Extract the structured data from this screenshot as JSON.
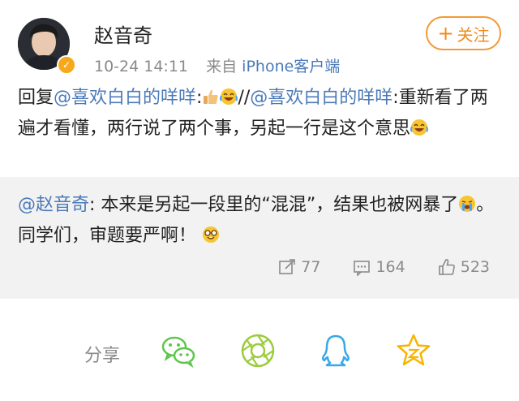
{
  "post": {
    "author": "赵音奇",
    "time": "10-24 14:11",
    "source_prefix": "来自",
    "source": "iPhone客户端",
    "follow_label": "关注",
    "content": {
      "reply_word": "回复",
      "mention1": "@喜欢白白的咩咩",
      "sep1": ":",
      "slash": "//",
      "mention2": "@喜欢白白的咩咩",
      "text2": ":重新看了两遍才看懂，两行说了两个事，另起一行是这个意思"
    }
  },
  "repost": {
    "mention": "@赵音奇",
    "text1": ": 本来是另起一段里的“混混”，结果也被网暴了",
    "text2": "。同学们，审题要严啊！",
    "stats": {
      "reposts": "77",
      "comments": "164",
      "likes": "523"
    }
  },
  "share": {
    "label": "分享",
    "targets": [
      "wechat-icon",
      "moments-icon",
      "qq-icon",
      "qzone-icon"
    ]
  },
  "colors": {
    "link": "#4b7ab8",
    "accent": "#f29b38",
    "gray": "#8a8a8a",
    "repost_bg": "#f2f2f2"
  }
}
